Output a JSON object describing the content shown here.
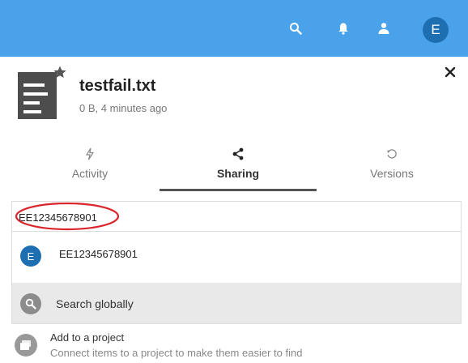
{
  "header": {
    "user_initial": "E",
    "icons": [
      "search-icon",
      "bell-icon",
      "contacts-icon"
    ],
    "bar_color": "#4aa3ea",
    "avatar_color": "#1e6fb1"
  },
  "file": {
    "name": "testfail.txt",
    "meta": "0 B, 4 minutes ago",
    "favorite_icon": "star-icon"
  },
  "tabs": [
    {
      "label": "Activity",
      "icon": "flash-icon",
      "active": false
    },
    {
      "label": "Sharing",
      "icon": "share-icon",
      "active": true
    },
    {
      "label": "Versions",
      "icon": "history-icon",
      "active": false
    }
  ],
  "share": {
    "input_value": "EE12345678901",
    "result": {
      "initial": "E",
      "name": "EE12345678901"
    },
    "search_globally_label": "Search globally",
    "highlight_color": "#d9262c"
  },
  "project": {
    "title": "Add to a project",
    "description": "Connect items to a project to make them easier to find"
  }
}
